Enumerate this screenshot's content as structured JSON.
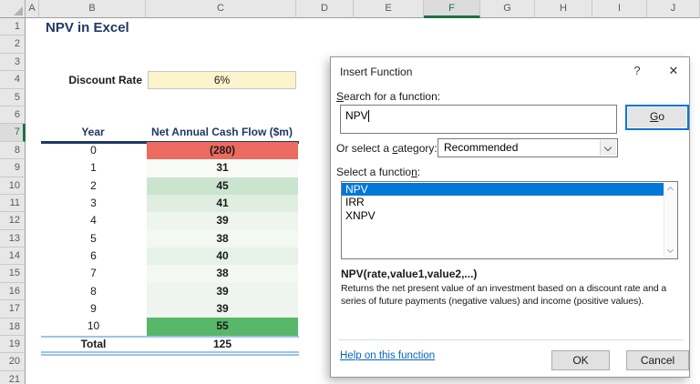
{
  "spreadsheet": {
    "column_headers": [
      "A",
      "B",
      "C",
      "D",
      "E",
      "F",
      "G",
      "H",
      "I",
      "J"
    ],
    "row_headers": [
      "1",
      "2",
      "3",
      "4",
      "5",
      "6",
      "7",
      "8",
      "9",
      "10",
      "11",
      "12",
      "13",
      "14",
      "15",
      "16",
      "17",
      "18",
      "19",
      "20",
      "21"
    ],
    "active_column": "F",
    "active_row": "7",
    "title": "NPV in Excel",
    "discount_rate": {
      "label": "Discount Rate",
      "value": "6%"
    },
    "table": {
      "headers": [
        "Year",
        "Net Annual Cash Flow ($m)"
      ],
      "rows": [
        {
          "year": "0",
          "value": "(280)",
          "bg": "#EC6B60"
        },
        {
          "year": "1",
          "value": "31",
          "bg": "#F8FAF8"
        },
        {
          "year": "2",
          "value": "45",
          "bg": "#CBE4CE"
        },
        {
          "year": "3",
          "value": "41",
          "bg": "#DFEEE1"
        },
        {
          "year": "4",
          "value": "39",
          "bg": "#EDF5EE"
        },
        {
          "year": "5",
          "value": "38",
          "bg": "#F3F8F3"
        },
        {
          "year": "6",
          "value": "40",
          "bg": "#E6F1E7"
        },
        {
          "year": "7",
          "value": "38",
          "bg": "#F3F8F3"
        },
        {
          "year": "8",
          "value": "39",
          "bg": "#EDF5EE"
        },
        {
          "year": "9",
          "value": "39",
          "bg": "#EDF5EE"
        },
        {
          "year": "10",
          "value": "55",
          "bg": "#58B768"
        }
      ],
      "total": {
        "label": "Total",
        "value": "125"
      }
    },
    "colors": {
      "title_navy": "#1F3864",
      "total_border_blue": "#9DC3E6",
      "negative_red": "#EC6B60",
      "max_green": "#58B768",
      "discount_bg": "#FBF4CC",
      "excel_green": "#217346"
    }
  },
  "dialog": {
    "title": "Insert Function",
    "icons": {
      "help": "?",
      "close": "✕"
    },
    "search": {
      "label_accel": "S",
      "label_rest": "earch for a function:",
      "value": "NPV"
    },
    "go": {
      "accel": "G",
      "rest": "o"
    },
    "category": {
      "label_pre": "Or select a ",
      "label_accel": "c",
      "label_rest": "ategory:",
      "value": "Recommended"
    },
    "select": {
      "label_pre": "Select a functio",
      "label_accel": "n",
      "label_rest": ":"
    },
    "functions": [
      {
        "name": "NPV",
        "selected": true
      },
      {
        "name": "IRR",
        "selected": false
      },
      {
        "name": "XNPV",
        "selected": false
      }
    ],
    "signature": "NPV(rate,value1,value2,...)",
    "description": "Returns the net present value of an investment based on a discount rate and a series of future payments (negative values) and income (positive values).",
    "help_link": "Help on this function",
    "ok_label": "OK",
    "cancel_label": "Cancel",
    "selection_blue": "#0078D7"
  }
}
